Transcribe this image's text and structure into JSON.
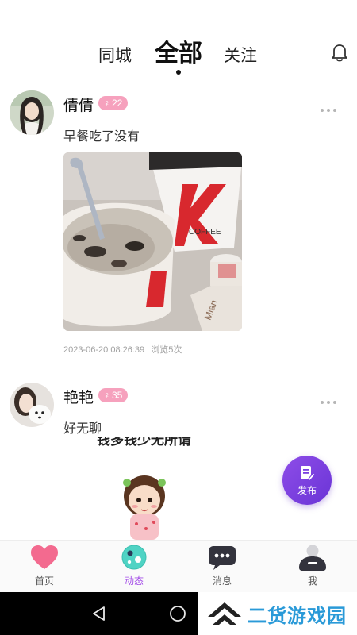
{
  "header": {
    "tabs": [
      {
        "label": "同城"
      },
      {
        "label": "全部"
      },
      {
        "label": "关注"
      }
    ],
    "bell_icon": "bell-icon"
  },
  "posts": [
    {
      "username": "倩倩",
      "gender_sign": "♀",
      "age": "22",
      "text": "早餐吃了没有",
      "image_description": "porridge-and-coffee-photo",
      "timestamp": "2023-06-20 08:26:39",
      "views": "浏览5次"
    },
    {
      "username": "艳艳",
      "gender_sign": "♀",
      "age": "35",
      "text": "好无聊",
      "partial_caption": "钱多钱少无所谓"
    }
  ],
  "fab": {
    "label": "发布"
  },
  "bottom_nav": {
    "items": [
      {
        "label": "首页",
        "icon": "heart-icon"
      },
      {
        "label": "动态",
        "icon": "moments-icon"
      },
      {
        "label": "消息",
        "icon": "message-icon"
      },
      {
        "label": "我",
        "icon": "profile-icon"
      }
    ]
  },
  "watermark": {
    "text": "二货游戏园"
  },
  "colors": {
    "badge_pink": "#f6a1bd",
    "accent_purple": "#a44de8",
    "fab_purple": "#7a3fe0",
    "heart_pink": "#f36a8f",
    "watermark_blue": "#2a9ad8"
  }
}
